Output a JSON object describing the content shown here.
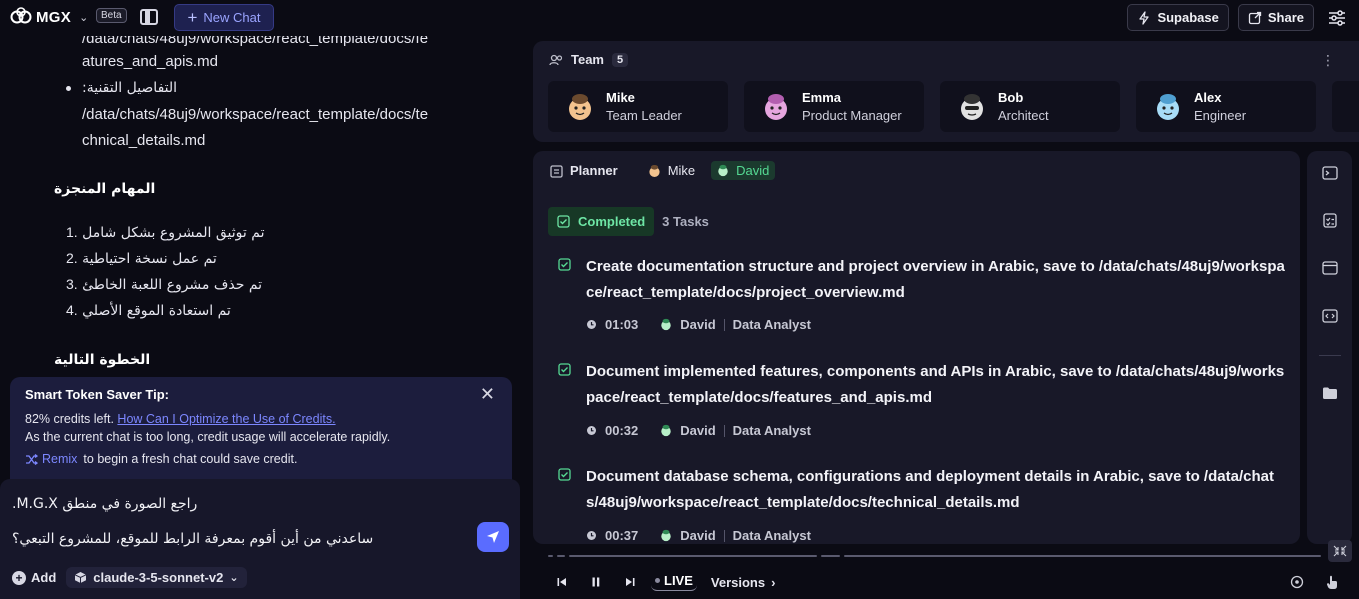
{
  "topbar": {
    "brand": "MGX",
    "beta": "Beta",
    "new_chat": "New Chat",
    "supabase": "Supabase",
    "share": "Share"
  },
  "chat": {
    "partial_path_top": "/data/chats/48uj9/workspace/react_template/docs/fe",
    "path_line2": "atures_and_apis.md",
    "bullet2_label": ":التفاصيل التقنية",
    "bullet2_path_l1": "/data/chats/48uj9/workspace/react_template/docs/te",
    "bullet2_path_l2": "chnical_details.md",
    "completed_heading": "المهام المنجزة",
    "completed_items": [
      {
        "num": "1.",
        "text": "تم توثيق المشروع بشكل شامل"
      },
      {
        "num": "2.",
        "text": "تم عمل نسخة احتياطية"
      },
      {
        "num": "3.",
        "text": "تم حذف مشروع اللعبة الخاطئ"
      },
      {
        "num": "4.",
        "text": "تم استعادة الموقع الأصلي"
      }
    ],
    "next_heading": "الخطوة التالية"
  },
  "tip": {
    "title": "Smart Token Saver Tip:",
    "credits": "82% credits left.",
    "link": "How Can I Optimize the Use of Credits.",
    "warning": "As the current chat is too long, credit usage will accelerate rapidly.",
    "remix": "Remix",
    "remix_suffix": "to begin a fresh chat could save credit."
  },
  "composer": {
    "line1": "راجع الصورة في منطق M.G.X.",
    "line2": "ساعدني من أين أقوم بمعرفة الرابط للموقع، للمشروع التبعي؟",
    "add": "Add",
    "model": "claude-3-5-sonnet-v2"
  },
  "team": {
    "title": "Team",
    "count": "5",
    "members": [
      {
        "name": "Mike",
        "role": "Team Leader",
        "color": "#f0b36a"
      },
      {
        "name": "Emma",
        "role": "Product Manager",
        "color": "#e79ad9"
      },
      {
        "name": "Bob",
        "role": "Architect",
        "color": "#d6d6d6"
      },
      {
        "name": "Alex",
        "role": "Engineer",
        "color": "#8fd3f4"
      }
    ]
  },
  "planner": {
    "tabs": {
      "planner": "Planner",
      "mike": "Mike",
      "david": "David"
    },
    "status": "Completed",
    "task_count": "3 Tasks",
    "tasks": [
      {
        "title": "Create documentation structure and project overview in Arabic, save to /data/chats/48uj9/workspace/react_template/docs/project_overview.md",
        "time": "01:03",
        "owner": "David",
        "role": "Data Analyst"
      },
      {
        "title": "Document implemented features, components and APIs in Arabic, save to /data/chats/48uj9/workspace/react_template/docs/features_and_apis.md",
        "time": "00:32",
        "owner": "David",
        "role": "Data Analyst"
      },
      {
        "title": "Document database schema, configurations and deployment details in Arabic, save to /data/chats/48uj9/workspace/react_template/docs/technical_details.md",
        "time": "00:37",
        "owner": "David",
        "role": "Data Analyst"
      }
    ]
  },
  "player": {
    "live": "LIVE",
    "versions": "Versions"
  },
  "colors": {
    "accent": "#5a6cff",
    "success": "#55d993",
    "link": "#7c87ff"
  }
}
